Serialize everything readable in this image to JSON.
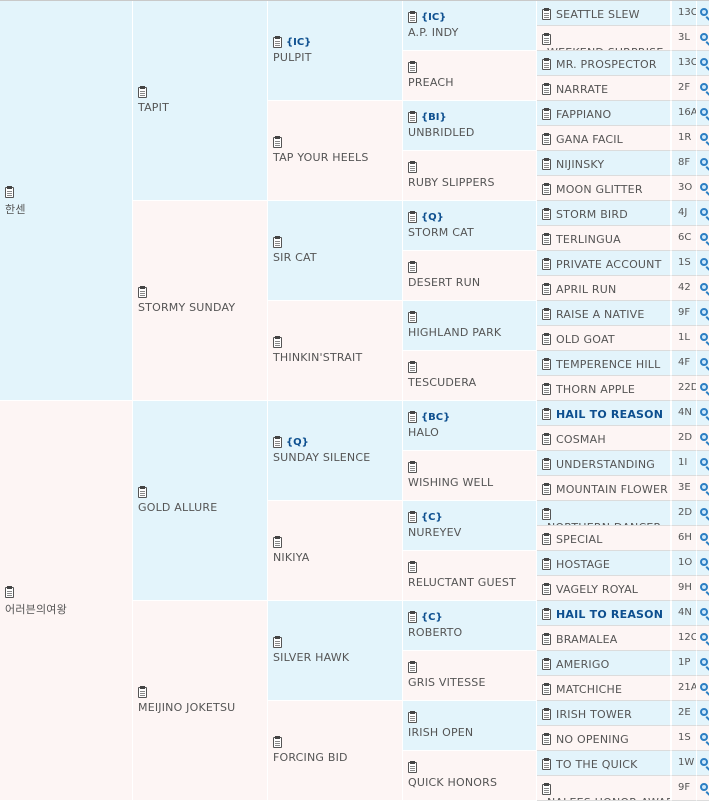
{
  "colors": {
    "blue_cell": "#e3f4fb",
    "pink_cell": "#fdf5f4",
    "tag": "#0d4f8f",
    "text": "#555555"
  },
  "pedigree": {
    "gen1": [
      {
        "name": "한센"
      },
      {
        "name": "어러븐의여왕"
      }
    ],
    "gen2": [
      {
        "name": "TAPIT"
      },
      {
        "name": "STORMY SUNDAY"
      },
      {
        "name": "GOLD ALLURE"
      },
      {
        "name": "MEIJINO JOKETSU"
      }
    ],
    "gen3": [
      {
        "name": "PULPIT",
        "tag": "{IC}"
      },
      {
        "name": "TAP YOUR HEELS"
      },
      {
        "name": "SIR CAT"
      },
      {
        "name": "THINKIN'STRAIT"
      },
      {
        "name": "SUNDAY SILENCE",
        "tag": "{Q}"
      },
      {
        "name": "NIKIYA"
      },
      {
        "name": "SILVER HAWK"
      },
      {
        "name": "FORCING BID"
      }
    ],
    "gen4": [
      {
        "name": "A.P. INDY",
        "tag": "{IC}"
      },
      {
        "name": "PREACH"
      },
      {
        "name": "UNBRIDLED",
        "tag": "{BI}"
      },
      {
        "name": "RUBY SLIPPERS"
      },
      {
        "name": "STORM CAT",
        "tag": "{Q}"
      },
      {
        "name": "DESERT RUN"
      },
      {
        "name": "HIGHLAND PARK"
      },
      {
        "name": "TESCUDERA"
      },
      {
        "name": "HALO",
        "tag": "{BC}"
      },
      {
        "name": "WISHING WELL"
      },
      {
        "name": "NUREYEV",
        "tag": "{C}"
      },
      {
        "name": "RELUCTANT GUEST"
      },
      {
        "name": "ROBERTO",
        "tag": "{C}"
      },
      {
        "name": "GRIS VITESSE"
      },
      {
        "name": "IRISH OPEN"
      },
      {
        "name": "QUICK HONORS"
      }
    ],
    "gen5": [
      {
        "name": "SEATTLE SLEW",
        "code": "13C"
      },
      {
        "name": "WEEKEND SURPRISE",
        "code": "3L"
      },
      {
        "name": "MR. PROSPECTOR",
        "code": "13C"
      },
      {
        "name": "NARRATE",
        "code": "2F"
      },
      {
        "name": "FAPPIANO",
        "code": "16A"
      },
      {
        "name": "GANA FACIL",
        "code": "1R"
      },
      {
        "name": "NIJINSKY",
        "code": "8F"
      },
      {
        "name": "MOON GLITTER",
        "code": "3O"
      },
      {
        "name": "STORM BIRD",
        "code": "4J"
      },
      {
        "name": "TERLINGUA",
        "code": "6C"
      },
      {
        "name": "PRIVATE ACCOUNT",
        "code": "1S"
      },
      {
        "name": "APRIL RUN",
        "code": "42"
      },
      {
        "name": "RAISE A NATIVE",
        "code": "9F"
      },
      {
        "name": "OLD GOAT",
        "code": "1L"
      },
      {
        "name": "TEMPERENCE HILL",
        "code": "4F"
      },
      {
        "name": "THORN APPLE",
        "code": "22D"
      },
      {
        "name": "HAIL TO REASON",
        "code": "4N"
      },
      {
        "name": "COSMAH",
        "code": "2D"
      },
      {
        "name": "UNDERSTANDING",
        "code": "1I"
      },
      {
        "name": "MOUNTAIN FLOWER",
        "code": "3E"
      },
      {
        "name": "NORTHERN DANCER",
        "code": "2D"
      },
      {
        "name": "SPECIAL",
        "code": "6H"
      },
      {
        "name": "HOSTAGE",
        "code": "1O"
      },
      {
        "name": "VAGELY ROYAL",
        "code": "9H"
      },
      {
        "name": "HAIL TO REASON",
        "code": "4N"
      },
      {
        "name": "BRAMALEA",
        "code": "12C"
      },
      {
        "name": "AMERIGO",
        "code": "1P"
      },
      {
        "name": "MATCHICHE",
        "code": "21A"
      },
      {
        "name": "IRISH TOWER",
        "code": "2E"
      },
      {
        "name": "NO OPENING",
        "code": "1S"
      },
      {
        "name": "TO THE QUICK",
        "code": "1W"
      },
      {
        "name": "NALEES HONOR AWARD",
        "code": "9F"
      }
    ]
  }
}
